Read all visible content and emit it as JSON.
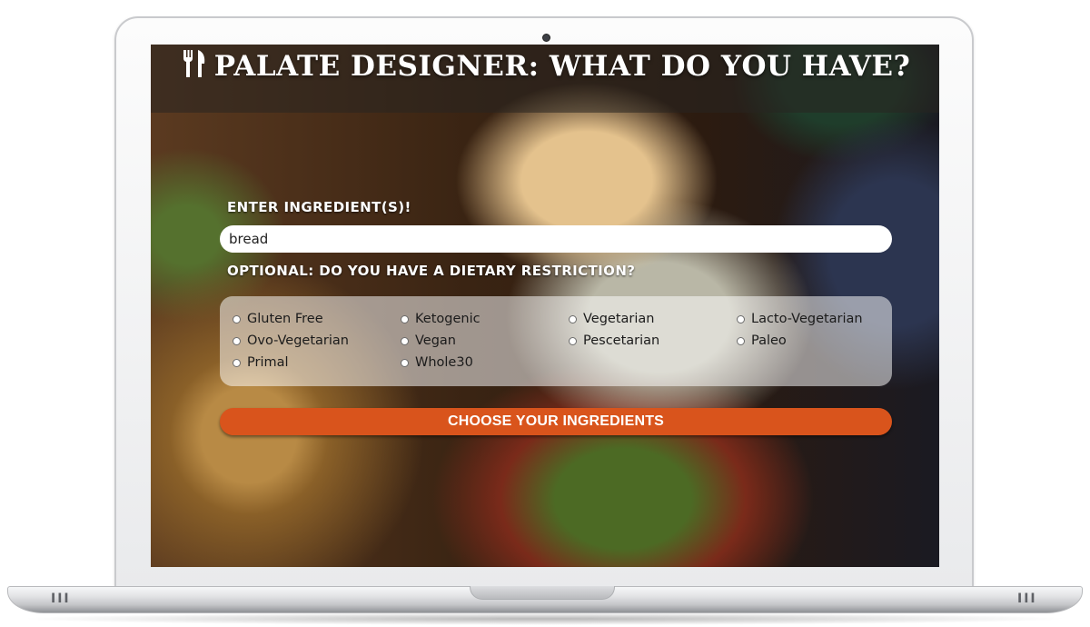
{
  "app": {
    "title": "PALATE DESIGNER: WHAT DO YOU HAVE?"
  },
  "form": {
    "ingredients_label": "ENTER INGREDIENT(S)!",
    "ingredients_value": "bread",
    "diet_label": "OPTIONAL: DO YOU HAVE A DIETARY RESTRICTION?",
    "diet_options": [
      {
        "label": "Gluten Free",
        "selected": false
      },
      {
        "label": "Ketogenic",
        "selected": false
      },
      {
        "label": "Vegetarian",
        "selected": false
      },
      {
        "label": "Lacto-Vegetarian",
        "selected": false
      },
      {
        "label": "Ovo-Vegetarian",
        "selected": false
      },
      {
        "label": "Vegan",
        "selected": false
      },
      {
        "label": "Pescetarian",
        "selected": false
      },
      {
        "label": "Paleo",
        "selected": false
      },
      {
        "label": "Primal",
        "selected": false
      },
      {
        "label": "Whole30",
        "selected": false
      }
    ],
    "submit_label": "CHOOSE YOUR INGREDIENTS"
  },
  "icons": {
    "title_icon": "fork-knife-icon"
  },
  "colors": {
    "accent_button": "#d9541c",
    "title_text": "#ffffff"
  }
}
